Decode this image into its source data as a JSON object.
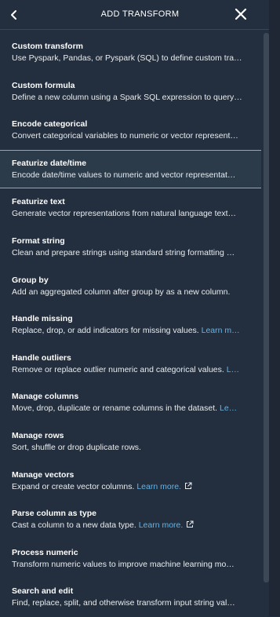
{
  "header": {
    "title": "ADD TRANSFORM",
    "back_icon": "chevron-left-icon",
    "close_icon": "close-icon"
  },
  "items": [
    {
      "name": "Custom transform",
      "desc": "Use Pyspark, Pandas, or Pyspark (SQL) to define custom tra…",
      "learn": ""
    },
    {
      "name": "Custom formula",
      "desc": "Define a new column using a Spark SQL expression to query…",
      "learn": ""
    },
    {
      "name": "Encode categorical",
      "desc": "Convert categorical variables to numeric or vector represent…",
      "learn": ""
    },
    {
      "name": "Featurize date/time",
      "desc": "Encode date/time values to numeric and vector representat…",
      "learn": ""
    },
    {
      "name": "Featurize text",
      "desc": "Generate vector representations from natural language text…",
      "learn": ""
    },
    {
      "name": "Format string",
      "desc": "Clean and prepare strings using standard string formatting …",
      "learn": ""
    },
    {
      "name": "Group by",
      "desc": "Add an aggregated column after group by as a new column.",
      "learn": ""
    },
    {
      "name": "Handle missing",
      "desc": "Replace, drop, or add indicators for missing values.",
      "learn": "Learn m…"
    },
    {
      "name": "Handle outliers",
      "desc": "Remove or replace outlier numeric and categorical values.",
      "learn": "L…"
    },
    {
      "name": "Manage columns",
      "desc": "Move, drop, duplicate or rename columns in the dataset.",
      "learn": "Le…"
    },
    {
      "name": "Manage rows",
      "desc": "Sort, shuffle or drop duplicate rows.",
      "learn": ""
    },
    {
      "name": "Manage vectors",
      "desc": "Expand or create vector columns.",
      "learn": "Learn more."
    },
    {
      "name": "Parse column as type",
      "desc": "Cast a column to a new data type.",
      "learn": "Learn more."
    },
    {
      "name": "Process numeric",
      "desc": "Transform numeric values to improve machine learning mo…",
      "learn": ""
    },
    {
      "name": "Search and edit",
      "desc": "Find, replace, split, and otherwise transform input string val…",
      "learn": ""
    }
  ],
  "selected_item": "Featurize date/time",
  "colors": {
    "background": "#232f3e",
    "selected_border": "#6fb3cc",
    "link": "#63b4e6"
  },
  "icons": {
    "external_link": "external-link-icon"
  }
}
